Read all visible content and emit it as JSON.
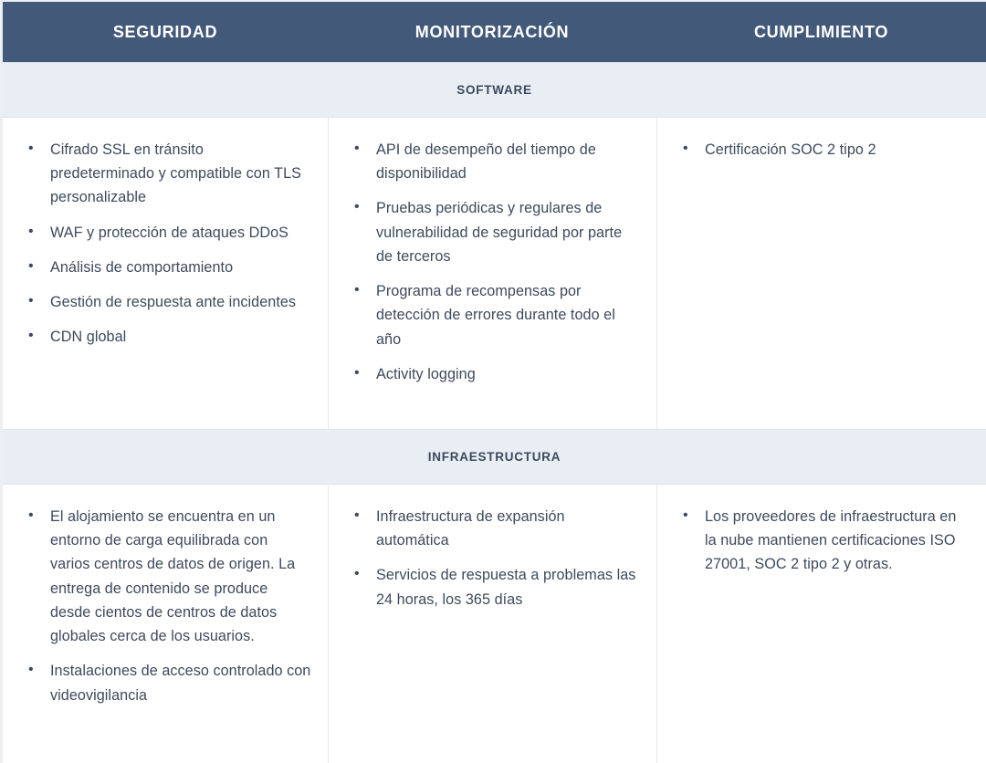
{
  "colors": {
    "header_bg": "#43597a",
    "header_text": "#ffffff",
    "section_band_bg": "#e9edf4",
    "section_band_text": "#3b4a5f",
    "body_text": "#3d4a5c",
    "divider": "#e5e7eb",
    "page_bg": "#eceef2",
    "cell_bg": "#ffffff"
  },
  "header": {
    "columns": [
      {
        "label": "SEGURIDAD"
      },
      {
        "label": "MONITORIZACIÓN"
      },
      {
        "label": "CUMPLIMIENTO"
      }
    ]
  },
  "sections": [
    {
      "band_label": "SOFTWARE",
      "columns": [
        {
          "items": [
            "Cifrado SSL en tránsito predeterminado y compatible con TLS personalizable",
            "WAF y protección de ataques DDoS",
            "Análisis de comportamiento",
            "Gestión de respuesta ante incidentes",
            "CDN global"
          ]
        },
        {
          "items": [
            "API de desempeño del tiempo de disponibilidad",
            "Pruebas periódicas y regulares de vulnerabilidad de seguridad por parte de terceros",
            "Programa de recompensas por detección de errores durante todo el año",
            "Activity logging"
          ]
        },
        {
          "items": [
            "Certificación SOC 2 tipo 2"
          ]
        }
      ]
    },
    {
      "band_label": "INFRAESTRUCTURA",
      "columns": [
        {
          "items": [
            "El alojamiento se encuentra en un entorno de carga equilibrada con varios centros de datos de origen. La entrega de contenido se produce desde cientos de centros de datos globales cerca de los usuarios.",
            "Instalaciones de acceso controlado con videovigilancia"
          ]
        },
        {
          "items": [
            "Infraestructura de expansión automática",
            "Servicios de respuesta a problemas las 24 horas, los 365 días"
          ]
        },
        {
          "items": [
            "Los proveedores de infraestructura en la nube mantienen certificaciones ISO 27001, SOC 2 tipo 2 y otras."
          ]
        }
      ]
    }
  ]
}
